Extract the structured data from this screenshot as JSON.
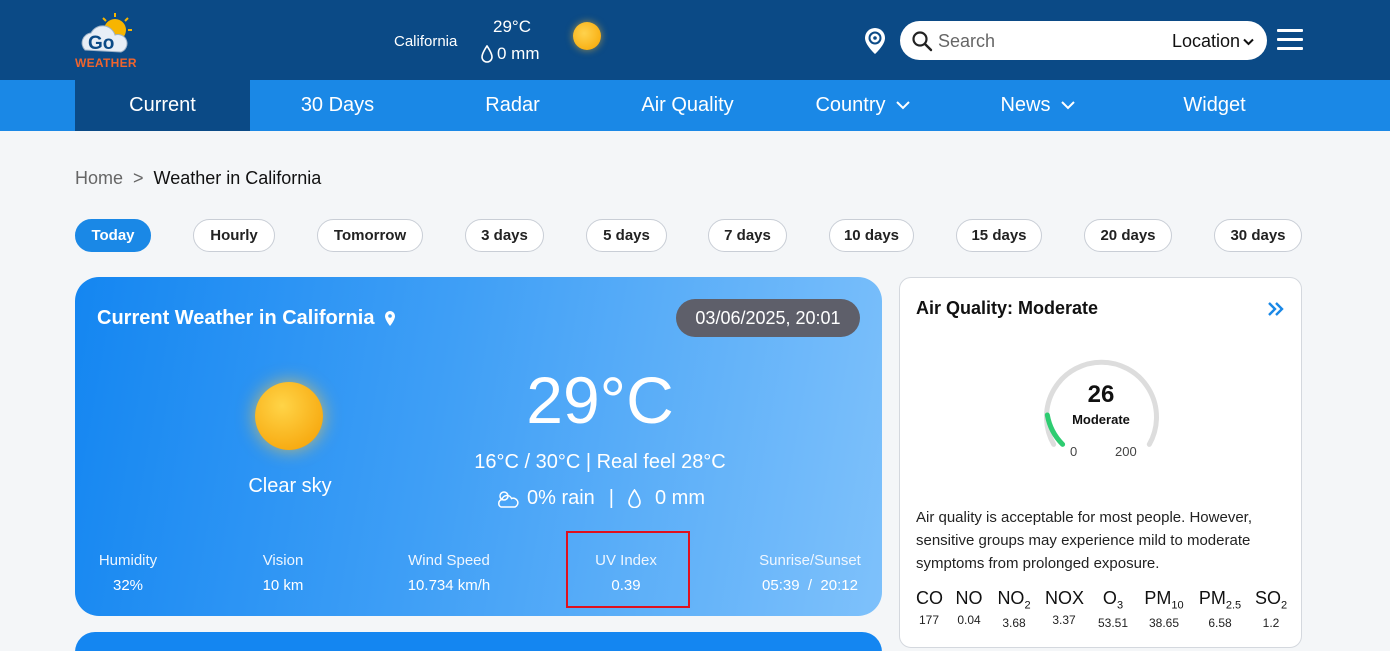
{
  "header": {
    "logo_text": "WEATHER",
    "logo_letters": "Go",
    "city": "California",
    "temp": "29°C",
    "rain": "0 mm",
    "search_placeholder": "Search",
    "location_label": "Location"
  },
  "nav": [
    {
      "label": "Current",
      "active": true
    },
    {
      "label": "30 Days"
    },
    {
      "label": "Radar"
    },
    {
      "label": "Air Quality"
    },
    {
      "label": "Country",
      "dropdown": true
    },
    {
      "label": "News",
      "dropdown": true
    },
    {
      "label": "Widget"
    }
  ],
  "breadcrumb": {
    "home": "Home",
    "separator": ">",
    "current": "Weather in California"
  },
  "pills": [
    "Today",
    "Hourly",
    "Tomorrow",
    "3 days",
    "5 days",
    "7 days",
    "10 days",
    "15 days",
    "20 days",
    "30 days"
  ],
  "current": {
    "title": "Current Weather in California",
    "datetime": "03/06/2025, 20:01",
    "condition": "Clear sky",
    "temp": "29°C",
    "range": "16°C / 30°C | Real feel 28°C",
    "rain_chance": "0% rain",
    "rain_sep": "|",
    "rain_amount": "0 mm",
    "stats": {
      "humidity": {
        "label": "Humidity",
        "value": "32%"
      },
      "vision": {
        "label": "Vision",
        "value": "10 km"
      },
      "wind": {
        "label": "Wind Speed",
        "value": "10.734 km/h"
      },
      "uv": {
        "label": "UV Index",
        "value": "0.39"
      },
      "sun": {
        "label": "Sunrise/Sunset",
        "value": "05:39  /  20:12"
      }
    }
  },
  "air_quality": {
    "title": "Air Quality: Moderate",
    "value": "26",
    "level": "Moderate",
    "min": "0",
    "max": "200",
    "fill_fraction": 0.13,
    "description": "Air quality is acceptable for most people. However, sensitive groups may experience mild to moderate symptoms from prolonged exposure.",
    "pollutants": {
      "co": {
        "value": "177"
      },
      "no": {
        "value": "0.04"
      },
      "no2": {
        "value": "3.68"
      },
      "nox": {
        "value": "3.37"
      },
      "o3": {
        "value": "53.51"
      },
      "pm10": {
        "value": "38.65"
      },
      "pm25": {
        "value": "6.58"
      },
      "so2": {
        "value": "1.2"
      }
    }
  },
  "colors": {
    "header_bg": "#0b4a86",
    "nav_bg": "#1a88e6",
    "accent": "#1a88e6",
    "gauge_fill": "#2ecc71",
    "highlight": "#e0101e"
  }
}
